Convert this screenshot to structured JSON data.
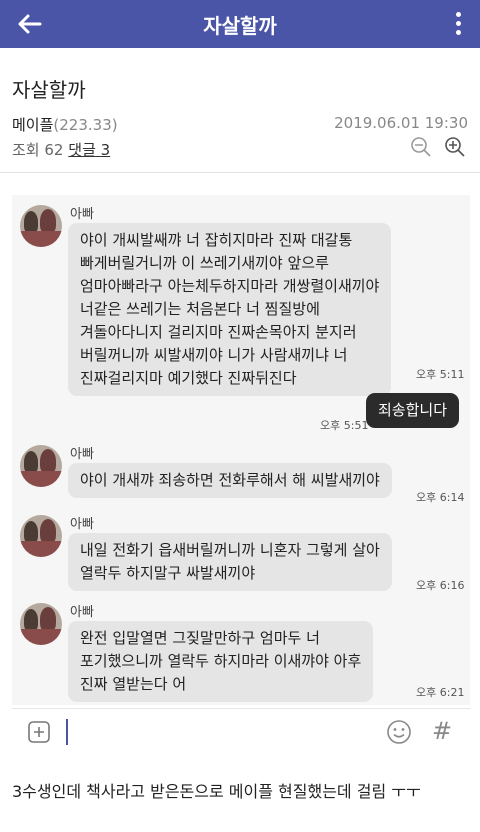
{
  "appbar": {
    "title": "자살할까",
    "back_icon": "arrow-left-icon",
    "more_icon": "more-vertical-icon",
    "color": "#4a55a8"
  },
  "post": {
    "title": "자살할까",
    "author": "메이플",
    "author_score": "(223.33)",
    "date": "2019.06.01 19:30",
    "views_label": "조회",
    "views": "62",
    "comments_label": "댓글",
    "comments": "3"
  },
  "chat": {
    "messages": [
      {
        "sender": "아빠",
        "text": "야이 개씨발쌔꺄 너 잡히지마라 진짜 대갈통\n빠게버릴거니까 이 쓰레기새끼야 앞으루\n엄마아빠라구 아는체두하지마라 개쌍렬이새끼야\n너같은 쓰레기는 처음본다 너 찜질방에\n겨돌아다니지 걸리지마 진짜손목아지 분지러\n버릴꺼니까 씨발새끼야 니가 사람새끼냐 너\n진짜걸리지마 예기했다 진짜뒤진다",
        "time": "오후 5:11"
      },
      {
        "text": "죄송합니다",
        "time": "오후 5:51"
      },
      {
        "sender": "아빠",
        "text": "야이 개새꺄 죄송하면 전화루해서 해 씨발새끼야",
        "time": "오후 6:14"
      },
      {
        "sender": "아빠",
        "text": "내일 전화기 읍새버릴꺼니까 니혼자 그렇게 살아\n열락두 하지말구 싸발새끼야",
        "time": "오후 6:16"
      },
      {
        "sender": "아빠",
        "text": "완전 입말열면 그짖말만하구 엄마두 너\n포기했으니까 열락두 하지마라 이새꺄야 아후\n진짜 열받는다 어",
        "time": "오후 6:21"
      }
    ]
  },
  "input": {
    "plus_icon": "plus-square-icon",
    "emoji_icon": "smiley-icon",
    "hash_label": "#"
  },
  "body_text": "3수생인데 책사라고 받은돈으로 메이플 현질했는데 걸림 ㅜㅜ"
}
